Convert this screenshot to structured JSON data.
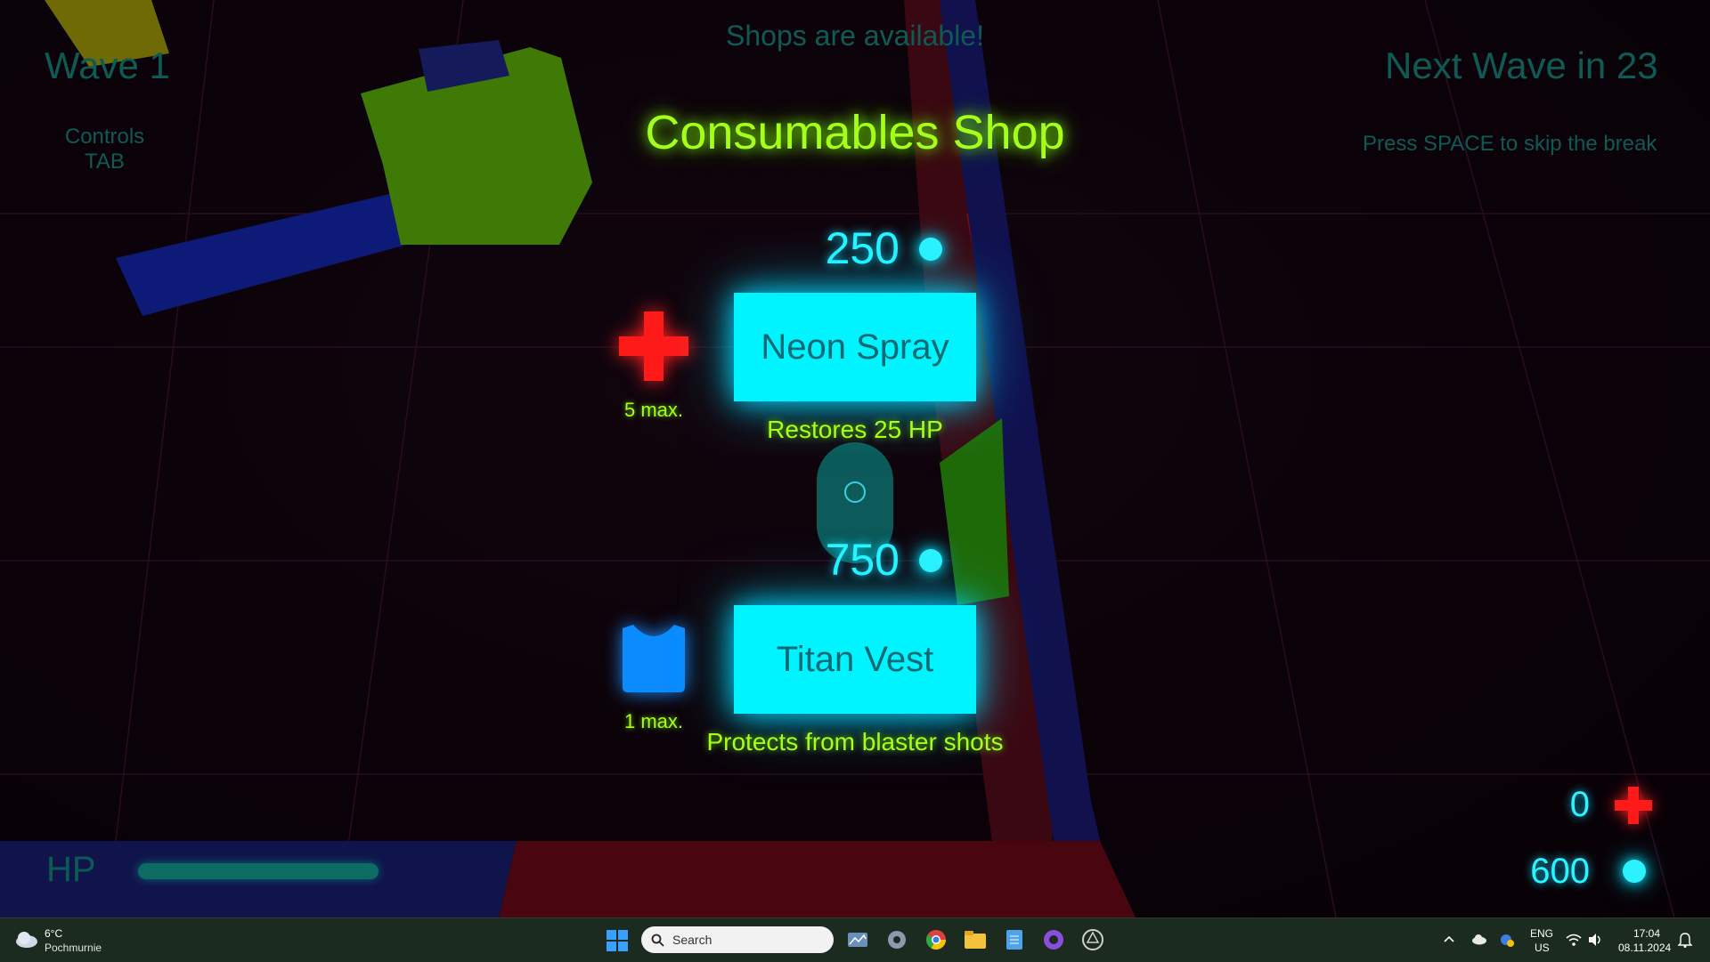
{
  "hud": {
    "wave": "Wave 1",
    "controls_line1": "Controls",
    "controls_line2": "TAB",
    "shops_available": "Shops are available!",
    "next_wave": "Next Wave in 23",
    "skip_hint": "Press SPACE to skip the break"
  },
  "shop": {
    "title": "Consumables Shop",
    "items": [
      {
        "name": "Neon Spray",
        "price": "250",
        "description": "Restores 25 HP",
        "limit": "5 max.",
        "icon": "red-cross-icon"
      },
      {
        "name": "Titan Vest",
        "price": "750",
        "description": "Protects from blaster shots",
        "limit": "1 max.",
        "icon": "vest-icon"
      }
    ]
  },
  "player": {
    "hp_label": "HP",
    "hp_fraction": 1.0,
    "health_packs": "0",
    "coins": "600"
  },
  "colors": {
    "neon_green": "#a6ff1a",
    "neon_cyan": "#00f4ff",
    "neon_red": "#ff1a1a",
    "vest_blue": "#0a8cff"
  },
  "taskbar": {
    "weather_temp": "6°C",
    "weather_desc": "Pochmurnie",
    "search_placeholder": "Search",
    "lang_line1": "ENG",
    "lang_line2": "US",
    "time": "17:04",
    "date": "08.11.2024",
    "icons": [
      "weather-icon",
      "windows-start-icon",
      "search-icon",
      "task-view-icon",
      "settings-icon",
      "chrome-icon",
      "file-explorer-icon",
      "notepad-icon",
      "github-icon",
      "unity-icon",
      "chevron-up-icon",
      "onedrive-icon",
      "wifi-icon",
      "speaker-icon",
      "notification-bell-icon"
    ]
  }
}
